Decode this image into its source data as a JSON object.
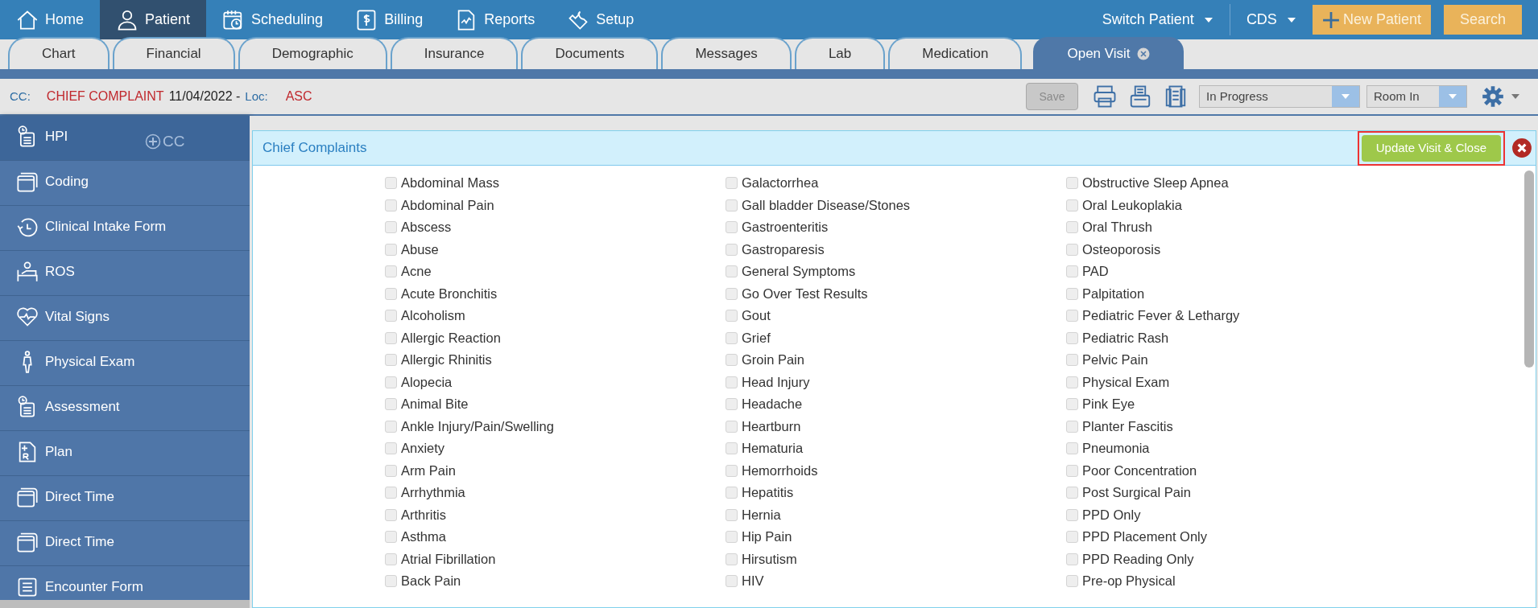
{
  "nav": {
    "items": [
      {
        "label": "Home",
        "selected": false
      },
      {
        "label": "Patient",
        "selected": true
      },
      {
        "label": "Scheduling",
        "selected": false
      },
      {
        "label": "Billing",
        "selected": false
      },
      {
        "label": "Reports",
        "selected": false
      },
      {
        "label": "Setup",
        "selected": false
      }
    ],
    "switch_patient": "Switch Patient",
    "cds": "CDS",
    "new_patient": "New Patient",
    "search": "Search"
  },
  "tabs": [
    {
      "label": "Chart",
      "selected": false
    },
    {
      "label": "Financial",
      "selected": false
    },
    {
      "label": "Demographic",
      "selected": false
    },
    {
      "label": "Insurance",
      "selected": false
    },
    {
      "label": "Documents",
      "selected": false
    },
    {
      "label": "Messages",
      "selected": false
    },
    {
      "label": "Lab",
      "selected": false
    },
    {
      "label": "Medication",
      "selected": false
    },
    {
      "label": "Open Visit",
      "selected": true,
      "closable": true
    }
  ],
  "visit_bar": {
    "cc_label": "CC:",
    "cc_value": "CHIEF COMPLAINT",
    "date": "11/04/2022 -",
    "loc_label": "Loc:",
    "loc_value": "ASC",
    "save": {
      "label": "Save",
      "disabled": true
    },
    "status": "In Progress",
    "room": "Room In"
  },
  "sidebar": {
    "items": [
      {
        "label": "HPI",
        "selected": true,
        "extra": "CC"
      },
      {
        "label": "Coding",
        "selected": false
      },
      {
        "label": "Clinical Intake Form",
        "selected": false
      },
      {
        "label": "ROS",
        "selected": false
      },
      {
        "label": "Vital Signs",
        "selected": false
      },
      {
        "label": "Physical Exam",
        "selected": false
      },
      {
        "label": "Assessment",
        "selected": false
      },
      {
        "label": "Plan",
        "selected": false
      },
      {
        "label": "Direct Time",
        "selected": false
      },
      {
        "label": "Direct Time",
        "selected": false
      },
      {
        "label": "Encounter Form",
        "selected": false
      }
    ]
  },
  "panel": {
    "title": "Chief Complaints",
    "update_button": "Update Visit & Close",
    "columns": [
      [
        {
          "label": "Abdominal Mass",
          "checked": false
        },
        {
          "label": "Abdominal Pain",
          "checked": false
        },
        {
          "label": "Abscess",
          "checked": false
        },
        {
          "label": "Abuse",
          "checked": false
        },
        {
          "label": "Acne",
          "checked": false
        },
        {
          "label": "Acute Bronchitis",
          "checked": false
        },
        {
          "label": "Alcoholism",
          "checked": false
        },
        {
          "label": "Allergic Reaction",
          "checked": false
        },
        {
          "label": "Allergic Rhinitis",
          "checked": false
        },
        {
          "label": "Alopecia",
          "checked": false
        },
        {
          "label": "Animal Bite",
          "checked": false
        },
        {
          "label": "Ankle Injury/Pain/Swelling",
          "checked": false
        },
        {
          "label": "Anxiety",
          "checked": false
        },
        {
          "label": "Arm Pain",
          "checked": false
        },
        {
          "label": "Arrhythmia",
          "checked": false
        },
        {
          "label": "Arthritis",
          "checked": false
        },
        {
          "label": "Asthma",
          "checked": false
        },
        {
          "label": "Atrial Fibrillation",
          "checked": false
        },
        {
          "label": "Back Pain",
          "checked": false
        }
      ],
      [
        {
          "label": "Galactorrhea",
          "checked": false
        },
        {
          "label": "Gall bladder Disease/Stones",
          "checked": false
        },
        {
          "label": "Gastroenteritis",
          "checked": false
        },
        {
          "label": "Gastroparesis",
          "checked": false
        },
        {
          "label": "General Symptoms",
          "checked": false
        },
        {
          "label": "Go Over Test Results",
          "checked": false
        },
        {
          "label": "Gout",
          "checked": false
        },
        {
          "label": "Grief",
          "checked": false
        },
        {
          "label": "Groin Pain",
          "checked": false
        },
        {
          "label": "Head Injury",
          "checked": false
        },
        {
          "label": "Headache",
          "checked": false
        },
        {
          "label": "Heartburn",
          "checked": false
        },
        {
          "label": "Hematuria",
          "checked": false
        },
        {
          "label": "Hemorrhoids",
          "checked": false
        },
        {
          "label": "Hepatitis",
          "checked": false
        },
        {
          "label": "Hernia",
          "checked": false
        },
        {
          "label": "Hip Pain",
          "checked": false
        },
        {
          "label": "Hirsutism",
          "checked": false
        },
        {
          "label": "HIV",
          "checked": false
        }
      ],
      [
        {
          "label": "Obstructive Sleep Apnea",
          "checked": false
        },
        {
          "label": "Oral Leukoplakia",
          "checked": false
        },
        {
          "label": "Oral Thrush",
          "checked": false
        },
        {
          "label": "Osteoporosis",
          "checked": false
        },
        {
          "label": "PAD",
          "checked": false
        },
        {
          "label": "Palpitation",
          "checked": false
        },
        {
          "label": "Pediatric Fever & Lethargy",
          "checked": false
        },
        {
          "label": "Pediatric Rash",
          "checked": false
        },
        {
          "label": "Pelvic Pain",
          "checked": false
        },
        {
          "label": "Physical Exam",
          "checked": false
        },
        {
          "label": "Pink Eye",
          "checked": false
        },
        {
          "label": "Planter Fascitis",
          "checked": false
        },
        {
          "label": "Pneumonia",
          "checked": false
        },
        {
          "label": "Poor Concentration",
          "checked": false
        },
        {
          "label": "Post Surgical Pain",
          "checked": false
        },
        {
          "label": "PPD Only",
          "checked": false
        },
        {
          "label": "PPD Placement Only",
          "checked": false
        },
        {
          "label": "PPD Reading Only",
          "checked": false
        },
        {
          "label": "Pre-op Physical",
          "checked": false
        }
      ]
    ]
  }
}
